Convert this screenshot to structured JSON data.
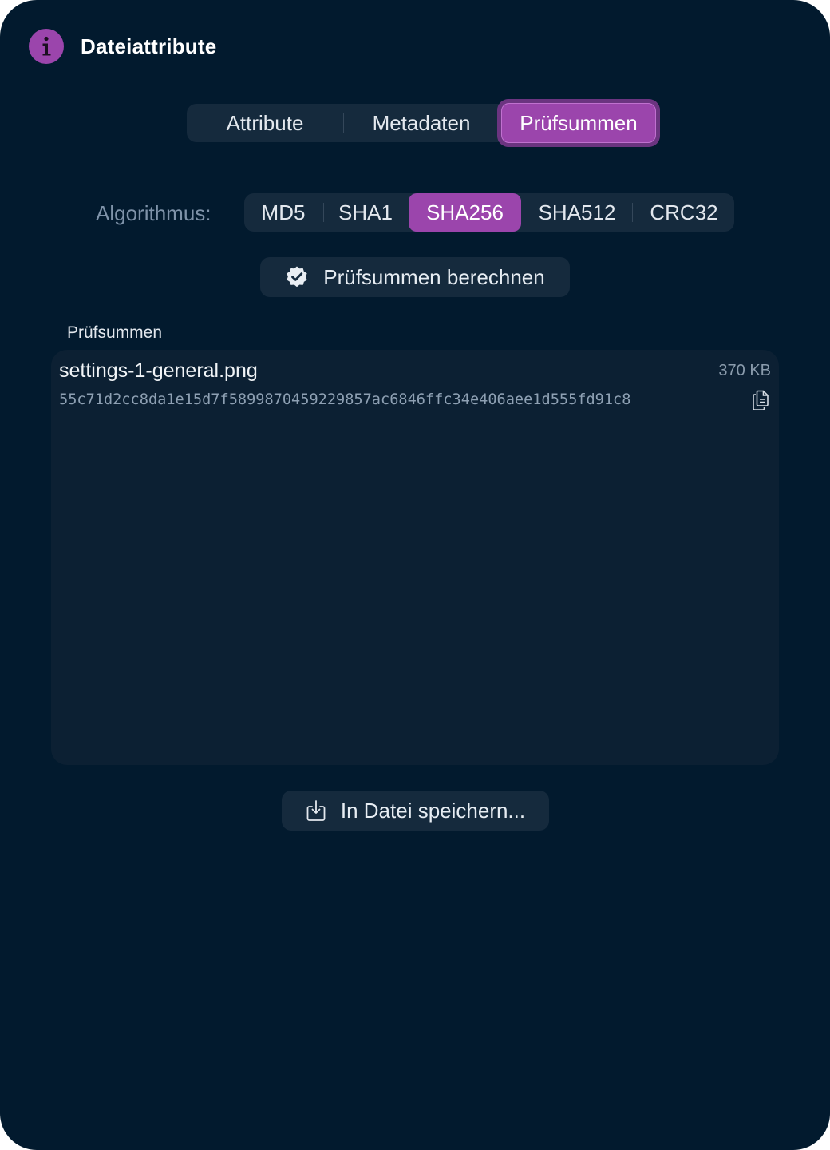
{
  "window": {
    "title": "Dateiattribute",
    "icon": "info-icon"
  },
  "tabs": [
    {
      "label": "Attribute",
      "selected": false
    },
    {
      "label": "Metadaten",
      "selected": false
    },
    {
      "label": "Prüfsummen",
      "selected": true
    }
  ],
  "algorithm": {
    "label": "Algorithmus:",
    "options": [
      "MD5",
      "SHA1",
      "SHA256",
      "SHA512",
      "CRC32"
    ],
    "selected": "SHA256"
  },
  "compute_button": {
    "label": "Prüfsummen berechnen",
    "icon": "checkmark-seal-icon"
  },
  "checksums": {
    "section_title": "Prüfsummen",
    "items": [
      {
        "file_name": "settings-1-general.png",
        "size": "370 KB",
        "hash": "55c71d2cc8da1e15d7f5899870459229857ac6846ffc34e406aee1d555fd91c8",
        "copy_icon": "copy-icon"
      }
    ]
  },
  "save_button": {
    "label": "In Datei speichern...",
    "icon": "save-to-file-icon"
  },
  "colors": {
    "background": "#021a2e",
    "accent": "#9b45ac",
    "control_background": "#152a3d",
    "panel_background": "#0c2033"
  }
}
